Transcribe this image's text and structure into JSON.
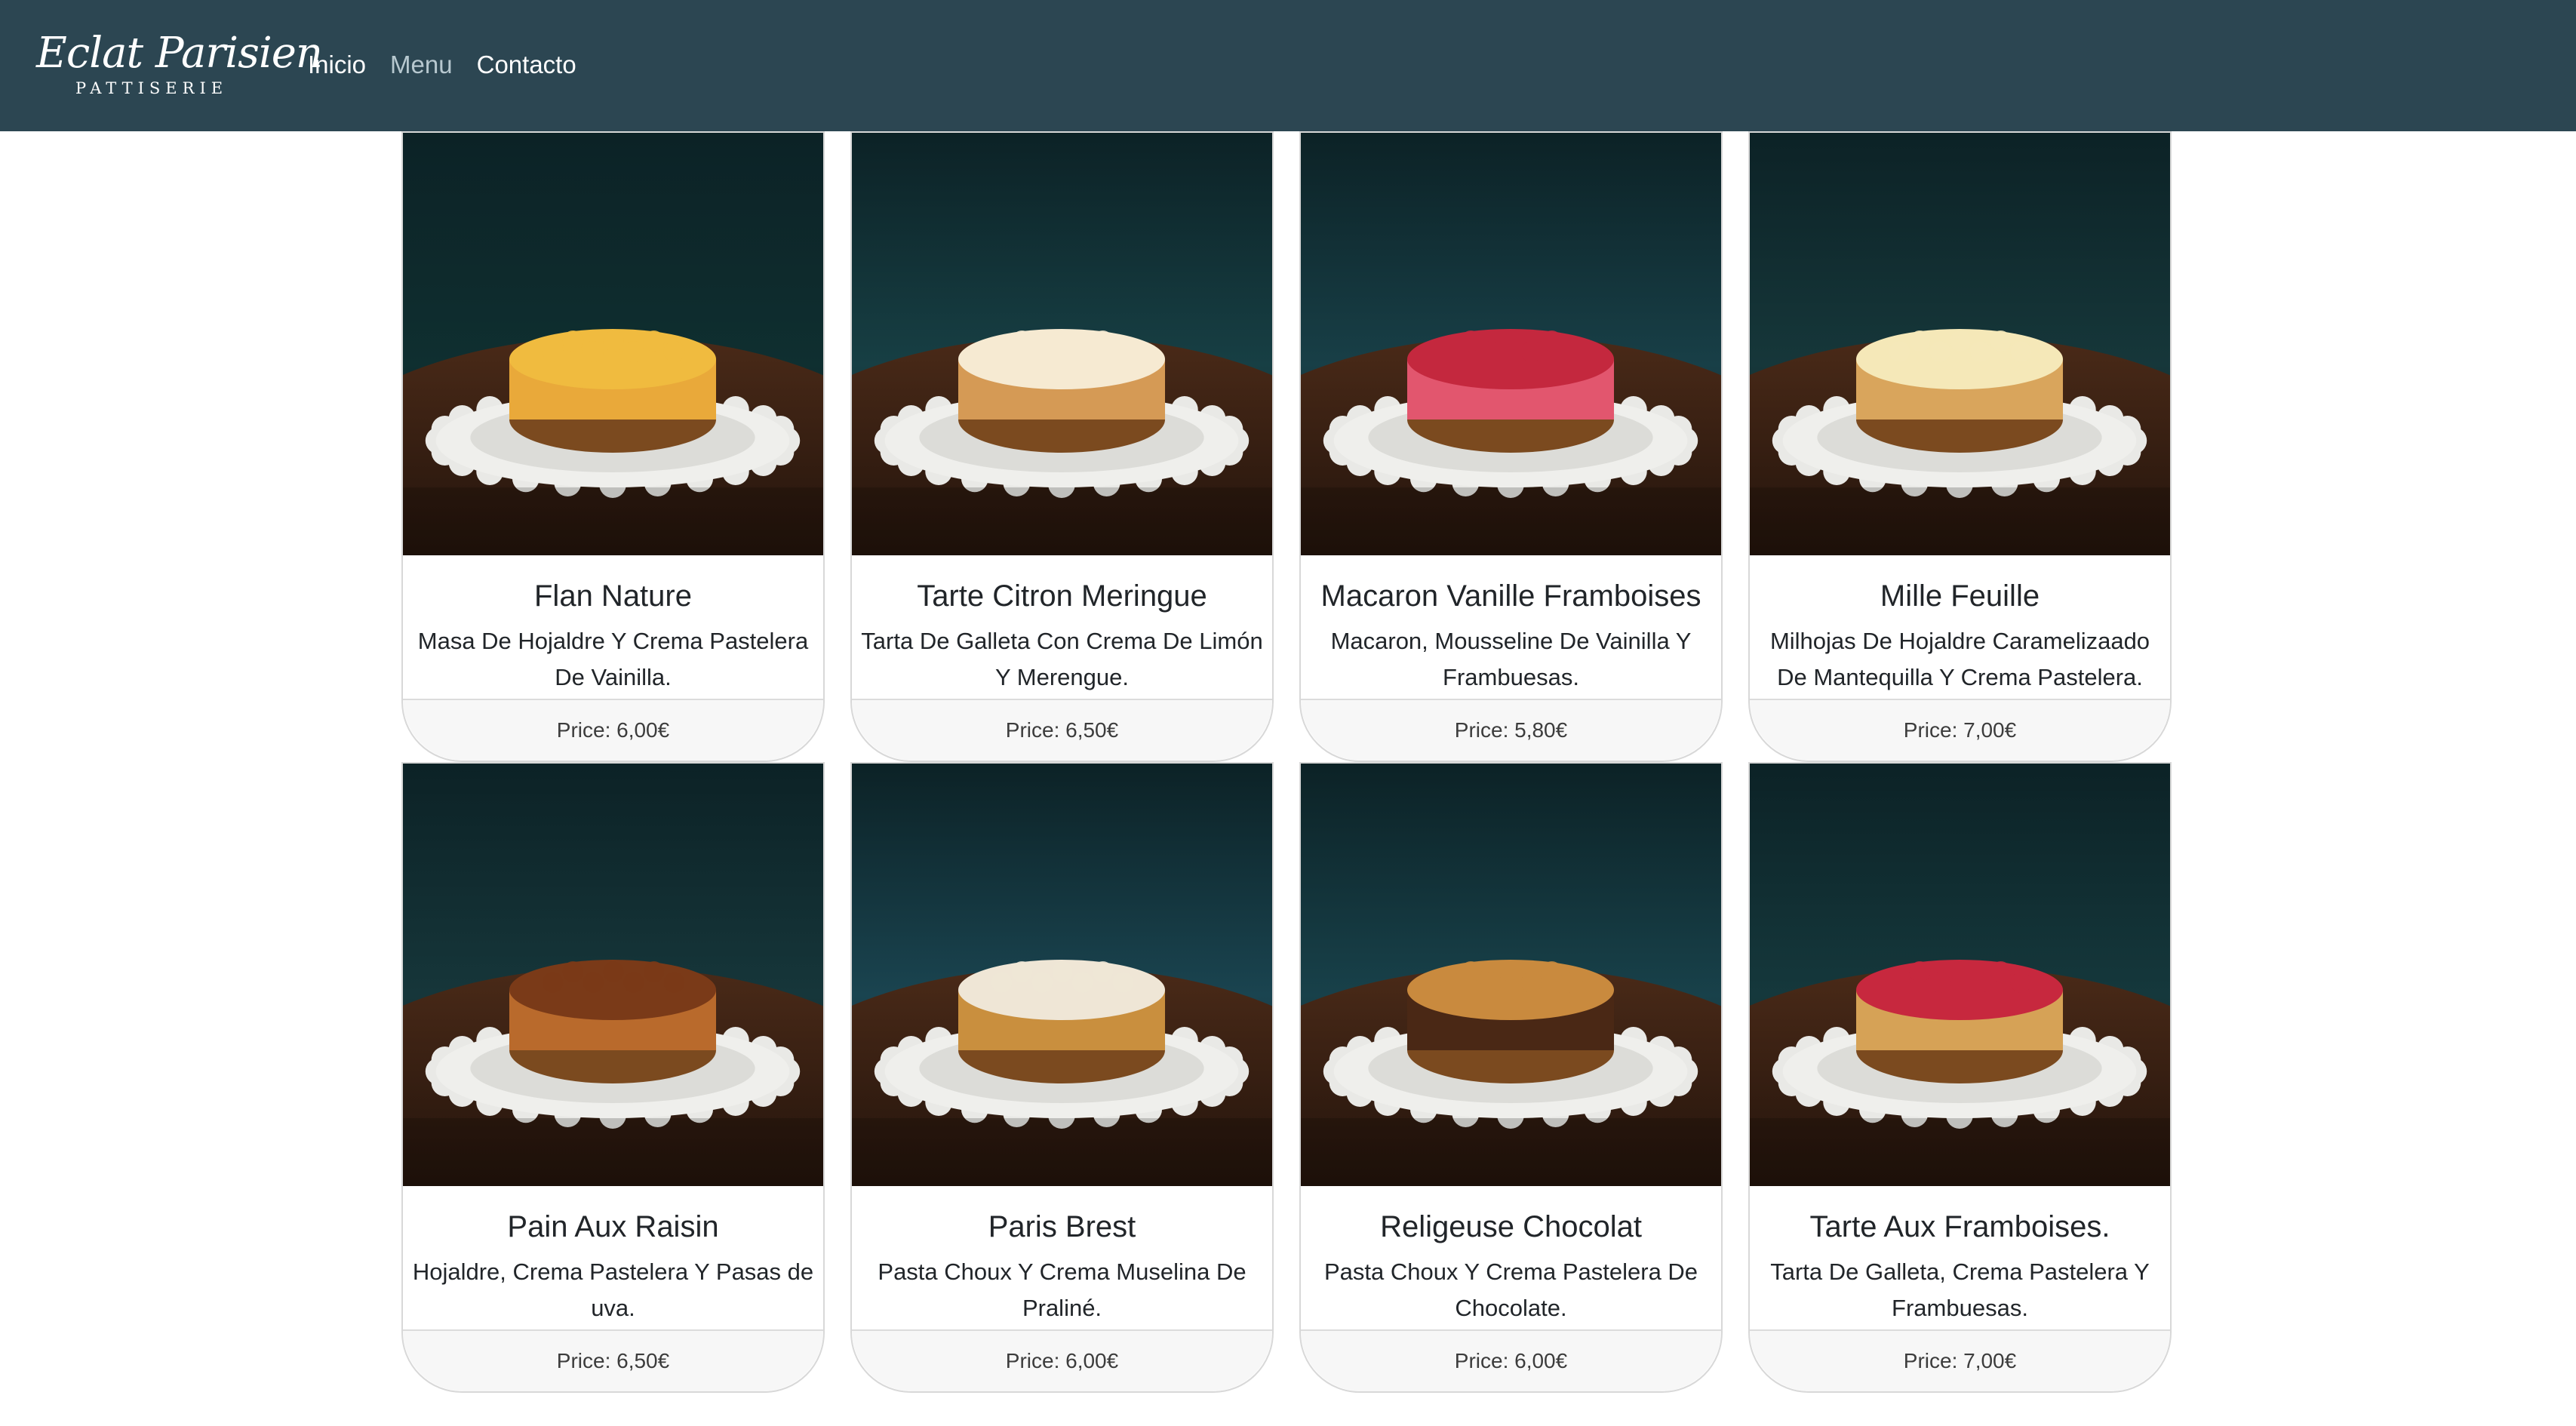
{
  "brand": {
    "name": "Eclat Parisien",
    "subtitle": "PATTISERIE"
  },
  "nav": {
    "items": [
      {
        "label": "Inicio",
        "active": false
      },
      {
        "label": "Menu",
        "active": true
      },
      {
        "label": "Contacto",
        "active": false
      }
    ]
  },
  "colors": {
    "navbar": "#2c4652",
    "nav_active": "#b7c8cf",
    "card_footer_bg": "#f7f7f7"
  },
  "products": [
    {
      "title": "Flan Nature",
      "description": "Masa De Hojaldre Y Crema Pastelera De Vainilla.",
      "price": "Price: 6,00€",
      "image_icon": "flan-tart-photo",
      "bg": "#0f2f30",
      "pastry": "#e9a93a",
      "topping": "#f0bb3f"
    },
    {
      "title": "Tarte Citron Meringue",
      "description": "Tarta De Galleta Con Crema De Limón Y Merengue.",
      "price": "Price: 6,50€",
      "image_icon": "lemon-meringue-tart-photo",
      "bg": "#173f44",
      "pastry": "#d59a55",
      "topping": "#f6ead2"
    },
    {
      "title": "Macaron Vanille Framboises",
      "description": "Macaron, Mousseline De Vainilla Y Frambuesas.",
      "price": "Price: 5,80€",
      "image_icon": "raspberry-macaron-photo",
      "bg": "#183f47",
      "pastry": "#e2566e",
      "topping": "#c4283e"
    },
    {
      "title": "Mille Feuille",
      "description": "Milhojas De Hojaldre Caramelizaado De Mantequilla Y Crema Pastelera.",
      "price": "Price: 7,00€",
      "image_icon": "mille-feuille-photo",
      "bg": "#16373a",
      "pastry": "#d9a55c",
      "topping": "#f5e8b8"
    },
    {
      "title": "Pain Aux Raisin",
      "description": "Hojaldre, Crema Pastelera Y Pasas de uva.",
      "price": "Price: 6,50€",
      "image_icon": "pain-aux-raisin-photo",
      "bg": "#16363a",
      "pastry": "#b96a2c",
      "topping": "#7a3a18"
    },
    {
      "title": "Paris Brest",
      "description": "Pasta Choux Y Crema Muselina De Praliné.",
      "price": "Price: 6,00€",
      "image_icon": "paris-brest-photo",
      "bg": "#1a4450",
      "pastry": "#c98f3e",
      "topping": "#efe6d6"
    },
    {
      "title": "Religeuse Chocolat",
      "description": "Pasta Choux Y Crema Pastelera De Chocolate.",
      "price": "Price: 6,00€",
      "image_icon": "religieuse-chocolat-photo",
      "bg": "#18414a",
      "pastry": "#4a2815",
      "topping": "#c98a3e"
    },
    {
      "title": "Tarte Aux Framboises.",
      "description": "Tarta De Galleta, Crema Pastelera Y Frambuesas.",
      "price": "Price: 7,00€",
      "image_icon": "raspberry-tart-photo",
      "bg": "#15383c",
      "pastry": "#d6a256",
      "topping": "#c7283e"
    }
  ]
}
